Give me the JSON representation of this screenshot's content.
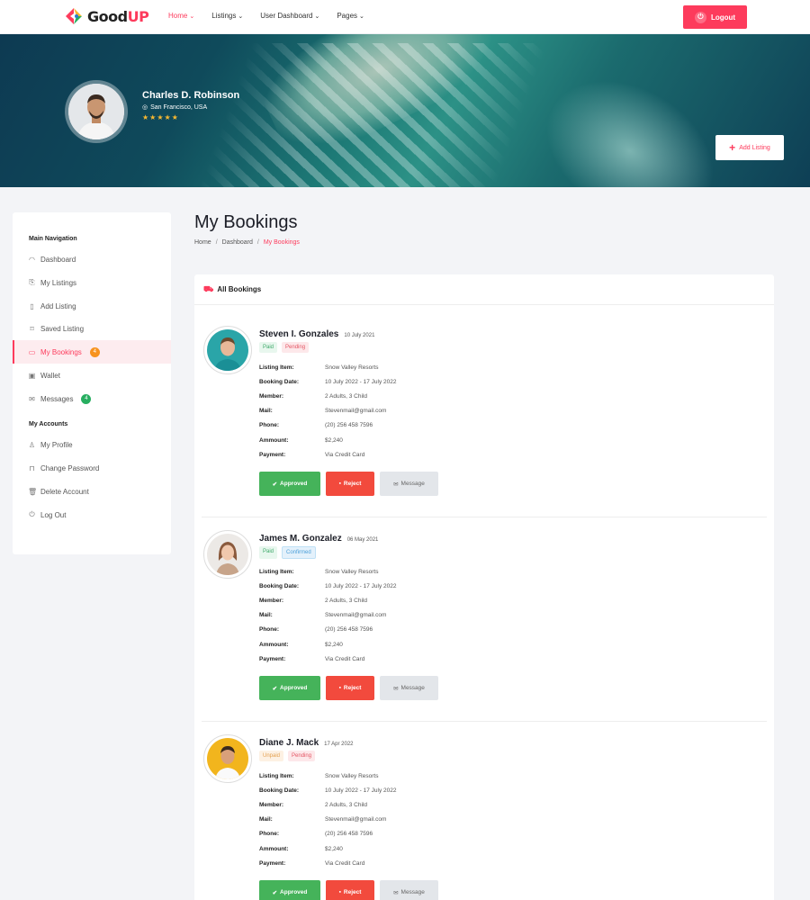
{
  "brand": {
    "name_main": "Good",
    "name_accent": "UP"
  },
  "nav": {
    "items": [
      {
        "label": "Home"
      },
      {
        "label": "Listings"
      },
      {
        "label": "User Dashboard"
      },
      {
        "label": "Pages"
      }
    ],
    "logout_label": "Logout"
  },
  "profile": {
    "name": "Charles D. Robinson",
    "location": "San Francisco, USA",
    "stars": "★★★★★",
    "add_listing_label": "Add Listing"
  },
  "sidebar": {
    "main_heading": "Main Navigation",
    "main_items": [
      {
        "label": "Dashboard",
        "icon": "dashboard-icon"
      },
      {
        "label": "My Listings",
        "icon": "listings-icon"
      },
      {
        "label": "Add Listing",
        "icon": "add-listing-icon"
      },
      {
        "label": "Saved Listing",
        "icon": "bookmark-icon"
      },
      {
        "label": "My Bookings",
        "icon": "bookings-icon",
        "badge": "4"
      },
      {
        "label": "Wallet",
        "icon": "wallet-icon"
      },
      {
        "label": "Messages",
        "icon": "messages-icon",
        "badge": "4"
      }
    ],
    "accounts_heading": "My Accounts",
    "account_items": [
      {
        "label": "My Profile",
        "icon": "user-icon"
      },
      {
        "label": "Change Password",
        "icon": "lock-icon"
      },
      {
        "label": "Delete Account",
        "icon": "trash-icon"
      },
      {
        "label": "Log Out",
        "icon": "power-icon"
      }
    ]
  },
  "page": {
    "title": "My Bookings",
    "breadcrumb": [
      "Home",
      "Dashboard",
      "My Bookings"
    ]
  },
  "panel": {
    "title": "All Bookings",
    "field_labels": {
      "listing": "Listing Item:",
      "booking_date": "Booking Date:",
      "member": "Member:",
      "mail": "Mail:",
      "phone": "Phone:",
      "amount": "Ammount:",
      "payment": "Payment:"
    },
    "buttons": {
      "approve": "Approved",
      "reject": "Reject",
      "message": "Message"
    },
    "bookings": [
      {
        "name": "Steven I. Gonzales",
        "date": "10 July 2021",
        "payment_status": "Paid",
        "booking_status": "Pending",
        "listing": "Snow Valley Resorts",
        "booking_date": "10 July 2022 - 17 July 2022",
        "member": "2 Adults, 3 Child",
        "mail": "Stevenmail@gmail.com",
        "phone": "(20) 256 458 7596",
        "amount": "$2,240",
        "payment": "Via Credit Card"
      },
      {
        "name": "James M. Gonzalez",
        "date": "06 May 2021",
        "payment_status": "Paid",
        "booking_status": "Confirmed",
        "listing": "Snow Valley Resorts",
        "booking_date": "10 July 2022 - 17 July 2022",
        "member": "2 Adults, 3 Child",
        "mail": "Stevenmail@gmail.com",
        "phone": "(20) 256 458 7596",
        "amount": "$2,240",
        "payment": "Via Credit Card"
      },
      {
        "name": "Diane J. Mack",
        "date": "17 Apr 2022",
        "payment_status": "Unpaid",
        "booking_status": "Pending",
        "listing": "Snow Valley Resorts",
        "booking_date": "10 July 2022 - 17 July 2022",
        "member": "2 Adults, 3 Child",
        "mail": "Stevenmail@gmail.com",
        "phone": "(20) 256 458 7596",
        "amount": "$2,240",
        "payment": "Via Credit Card"
      }
    ]
  },
  "colors": {
    "accent": "#fd3b5c",
    "approve": "#45b35a",
    "reject": "#f24a3d",
    "star": "#f9b931"
  }
}
